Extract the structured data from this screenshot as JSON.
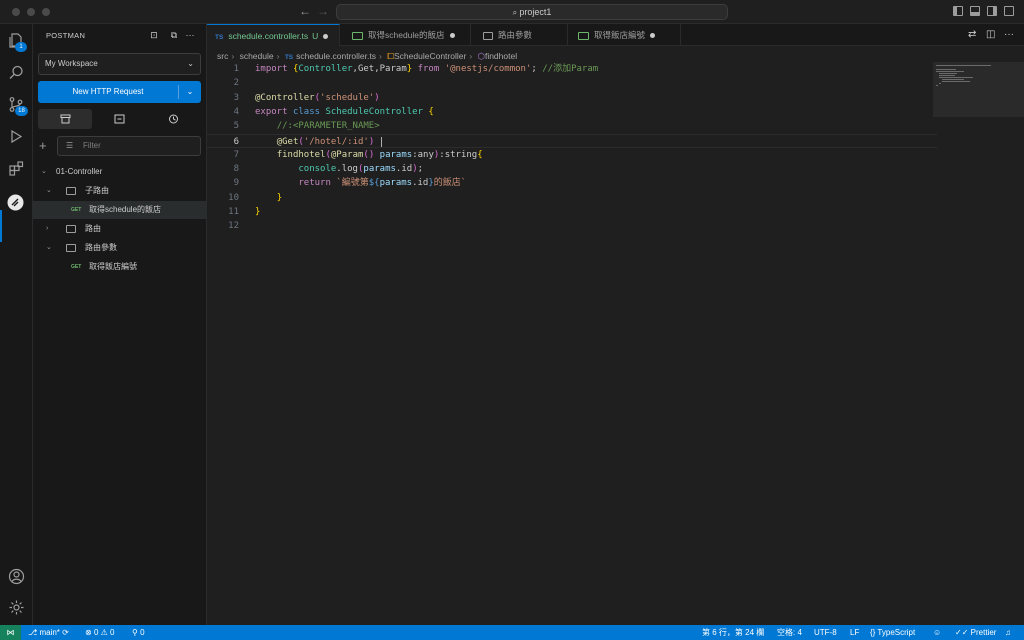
{
  "titlebar": {
    "search_label": "project1"
  },
  "activity_bar": {
    "badges": {
      "explorer": "1",
      "source_control": "18"
    }
  },
  "sidebar": {
    "title": "POSTMAN",
    "workspace": "My Workspace",
    "new_request_label": "New HTTP Request",
    "filter_placeholder": "Filter",
    "tree": [
      {
        "label": "01-Controller",
        "level": 0,
        "type": "collection",
        "expanded": true
      },
      {
        "label": "子路由",
        "level": 1,
        "type": "folder",
        "expanded": true
      },
      {
        "label": "取得schedule的飯店",
        "level": 2,
        "type": "request",
        "method": "GET",
        "selected": true
      },
      {
        "label": "路由",
        "level": 1,
        "type": "folder",
        "expanded": false
      },
      {
        "label": "路由參數",
        "level": 1,
        "type": "folder",
        "expanded": true
      },
      {
        "label": "取得飯店編號",
        "level": 2,
        "type": "request",
        "method": "GET"
      }
    ]
  },
  "editor": {
    "tabs": [
      {
        "label": "schedule.controller.ts",
        "kind": "TS",
        "status": "U",
        "modified": true,
        "active": true
      },
      {
        "label": "取得schedule的飯店",
        "kind": "postman-request",
        "modified": true
      },
      {
        "label": "路由參數",
        "kind": "folder"
      },
      {
        "label": "取得飯店編號",
        "kind": "postman-request",
        "modified": true
      }
    ],
    "breadcrumbs": [
      "src",
      "schedule",
      "schedule.controller.ts",
      "ScheduleController",
      "findhotel"
    ],
    "cursor_line": 6,
    "code_lines": [
      "import {Controller,Get,Param} from '@nestjs/common'; //添加Param",
      "",
      "@Controller('schedule')",
      "export class ScheduleController {",
      "    //:<PARAMETER_NAME>",
      "    @Get('/hotel/:id') ",
      "    findhotel(@Param() params:any):string{",
      "        console.log(params.id);",
      "        return `編號第${params.id}的飯店`",
      "    }",
      "}",
      ""
    ]
  },
  "statusbar": {
    "branch": "main*",
    "errors": "0",
    "warnings": "0",
    "ports": "0",
    "position": "第 6 行，第 24 欄",
    "spaces": "空格: 4",
    "encoding": "UTF-8",
    "eol": "LF",
    "language": "TypeScript",
    "formatter": "Prettier"
  },
  "colors": {
    "accent": "#0078d4",
    "background": "#1f1f1f",
    "sidebar": "#181818"
  }
}
